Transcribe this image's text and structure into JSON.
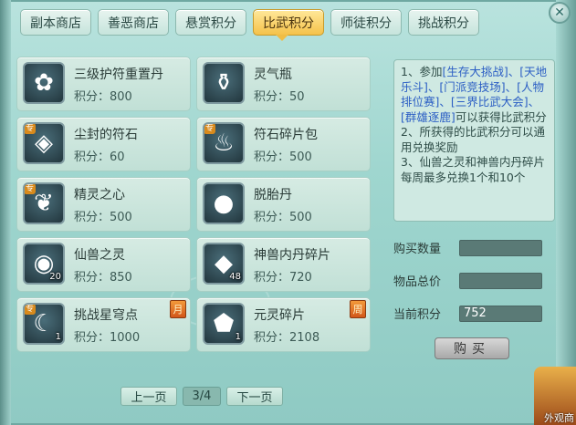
{
  "tabs": [
    {
      "label": "副本商店"
    },
    {
      "label": "善恶商店"
    },
    {
      "label": "悬赏积分"
    },
    {
      "label": "比武积分",
      "active": true
    },
    {
      "label": "师徒积分"
    },
    {
      "label": "挑战积分"
    }
  ],
  "price_prefix": "积分：",
  "items": [
    {
      "name": "三级护符重置丹",
      "price": "800",
      "icon": "golden-pill-icon",
      "glyph": "✿",
      "count": ""
    },
    {
      "name": "灵气瓶",
      "price": "50",
      "icon": "vase-icon",
      "glyph": "⚱",
      "count": ""
    },
    {
      "name": "尘封的符石",
      "price": "60",
      "icon": "rune-stone-icon",
      "glyph": "◈",
      "count": "",
      "zhuan": "专"
    },
    {
      "name": "符石碎片包",
      "price": "500",
      "icon": "pouch-icon",
      "glyph": "♨",
      "count": "",
      "zhuan": "专"
    },
    {
      "name": "精灵之心",
      "price": "500",
      "icon": "spirit-heart-icon",
      "glyph": "❦",
      "count": "",
      "zhuan": "专"
    },
    {
      "name": "脱胎丹",
      "price": "500",
      "icon": "pill-cluster-icon",
      "glyph": "●",
      "count": ""
    },
    {
      "name": "仙兽之灵",
      "price": "850",
      "icon": "beast-orb-icon",
      "glyph": "◉",
      "count": "20"
    },
    {
      "name": "神兽内丹碎片",
      "price": "720",
      "icon": "crystal-shard-icon",
      "glyph": "◆",
      "count": "48"
    },
    {
      "name": "挑战星穹点",
      "price": "1000",
      "icon": "crescent-moon-icon",
      "glyph": "☾",
      "count": "1",
      "zhuan": "专",
      "limit": "月"
    },
    {
      "name": "元灵碎片",
      "price": "2108",
      "icon": "gold-fragment-icon",
      "glyph": "⬟",
      "count": "1",
      "limit": "周"
    }
  ],
  "pager": {
    "prev": "上一页",
    "page": "3/4",
    "next": "下一页"
  },
  "description": {
    "line1_a": "1、参加",
    "line1_links": "[生存大挑战]、[天地乐斗]、[门派竞技场]、[人物排位赛]、[三界比武大会]、[群雄逐鹿]",
    "line1_b": "可以获得比武积分",
    "line2": "2、所获得的比武积分可以通用兑换奖励",
    "line3": "3、仙兽之灵和神兽内丹碎片每周最多兑换1个和10个"
  },
  "form": {
    "qty_label": "购买数量",
    "qty_value": "",
    "total_label": "物品总价",
    "total_value": "",
    "current_label": "当前积分",
    "current_value": "752"
  },
  "buy_label": "购买",
  "corner_text": "外观商",
  "colors": {
    "active_tab": "#f5c24a",
    "link": "#2b5ec4",
    "panel": "#9fd6cf"
  }
}
